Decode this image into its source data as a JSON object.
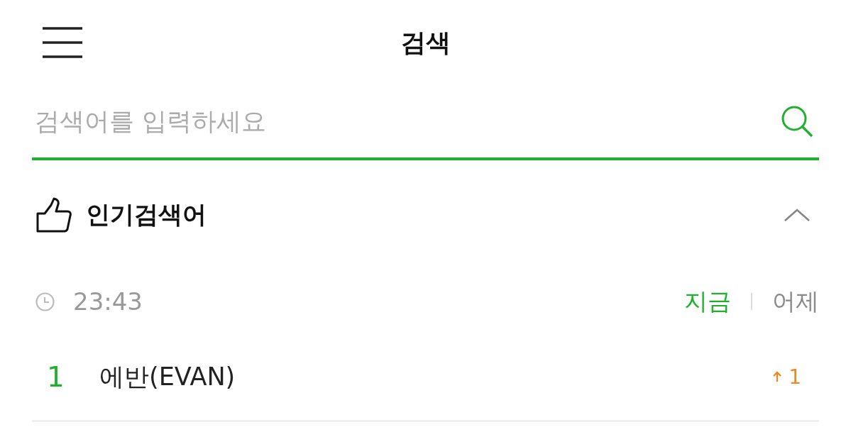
{
  "header": {
    "title": "검색"
  },
  "search": {
    "placeholder": "검색어를 입력하세요"
  },
  "popular": {
    "title": "인기검색어",
    "expanded": true,
    "time": "23:43",
    "periods": [
      {
        "label": "지금",
        "selected": true
      },
      {
        "label": "어제",
        "selected": false
      }
    ],
    "rankings": [
      {
        "rank": "1",
        "keyword": "에반(EVAN)",
        "change": "1",
        "kind": "rise"
      }
    ]
  }
}
